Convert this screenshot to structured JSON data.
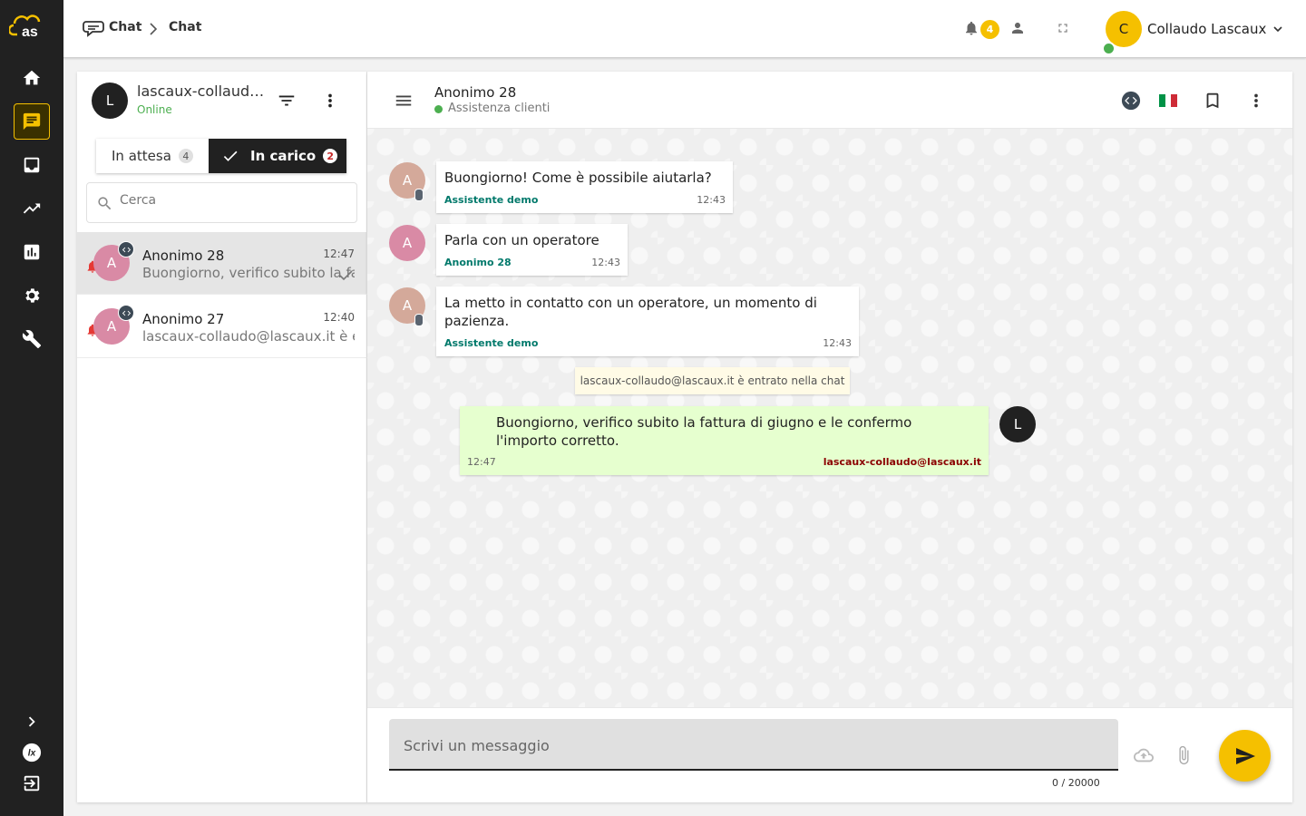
{
  "breadcrumb": {
    "root": "Chat",
    "current": "Chat"
  },
  "notifications": {
    "count": "4"
  },
  "user": {
    "initial": "C",
    "name": "Collaudo Lascaux"
  },
  "operator": {
    "initial": "L",
    "name": "lascaux-collaudo@lascaux.it",
    "status": "Online"
  },
  "tabs": {
    "waiting": {
      "label": "In attesa",
      "count": "4"
    },
    "assigned": {
      "label": "In carico",
      "count": "2"
    }
  },
  "search": {
    "placeholder": "Cerca",
    "value": ""
  },
  "conversations": [
    {
      "initial": "A",
      "name": "Anonimo 28",
      "time": "12:47",
      "preview": "Buongiorno, verifico subito la fattura di giugno e le confermo l'importo corretto."
    },
    {
      "initial": "A",
      "name": "Anonimo 27",
      "time": "12:40",
      "preview": "lascaux-collaudo@lascaux.it è entrato nella chat"
    }
  ],
  "chat": {
    "title": "Anonimo 28",
    "subtitle": "Assistenza clienti",
    "messages": [
      {
        "initial": "A",
        "text": "Buongiorno! Come è possibile aiutarla?",
        "sender": "Assistente demo",
        "time": "12:43"
      },
      {
        "initial": "A",
        "text": "Parla con un operatore",
        "sender": "Anonimo 28",
        "time": "12:43"
      },
      {
        "initial": "A",
        "text": "La metto in contatto con un operatore, un momento di pazienza.",
        "sender": "Assistente demo",
        "time": "12:43"
      }
    ],
    "system_message": "lascaux-collaudo@lascaux.it è entrato nella chat",
    "outgoing": {
      "initial": "L",
      "text": "Buongiorno, verifico subito la fattura di giugno e le confermo l'importo corretto.",
      "sender": "lascaux-collaudo@lascaux.it",
      "time": "12:47"
    }
  },
  "composer": {
    "placeholder": "Scrivi un messaggio",
    "counter": "0 / 20000"
  },
  "colors": {
    "accent": "#f5c000",
    "rail": "#212121",
    "online": "#4caf50",
    "outgoing_bubble": "#e6ffcf",
    "visitor_avatar": "#d98aa5",
    "bot_avatar": "#d4a99a"
  }
}
